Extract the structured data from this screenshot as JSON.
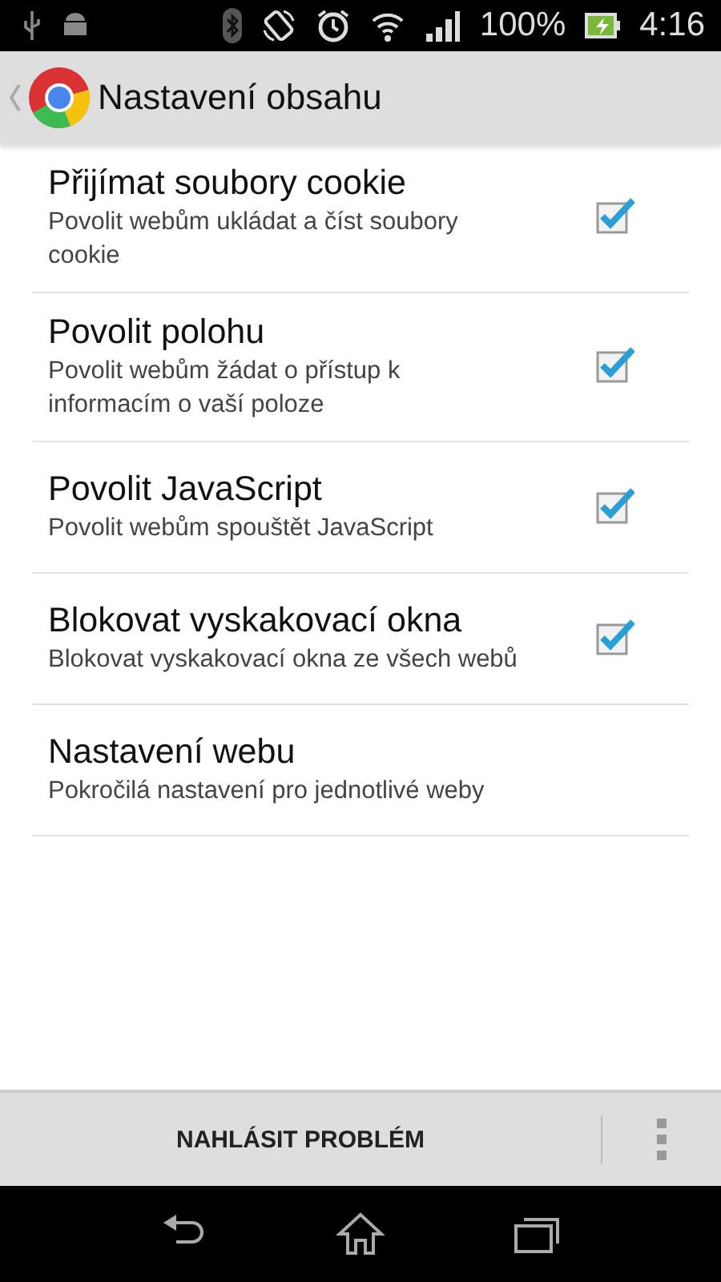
{
  "status_bar": {
    "battery": "100%",
    "time": "4:16"
  },
  "action_bar": {
    "title": "Nastavení obsahu"
  },
  "settings": [
    {
      "kind": "checkbox",
      "title": "Přijímat soubory cookie",
      "summary": "Povolit webům ukládat a číst soubory cookie",
      "checked": true
    },
    {
      "kind": "checkbox",
      "title": "Povolit polohu",
      "summary": "Povolit webům žádat o přístup k informacím o vaší poloze",
      "checked": true
    },
    {
      "kind": "checkbox",
      "title": "Povolit JavaScript",
      "summary": "Povolit webům spouštět JavaScript",
      "checked": true
    },
    {
      "kind": "checkbox",
      "title": "Blokovat vyskakovací okna",
      "summary": "Blokovat vyskakovací okna ze všech webů",
      "checked": true
    },
    {
      "kind": "link",
      "title": "Nastavení webu",
      "summary": "Pokročilá nastavení pro jednotlivé weby"
    }
  ],
  "bottom_bar": {
    "button": "NAHLÁSIT PROBLÉM"
  }
}
